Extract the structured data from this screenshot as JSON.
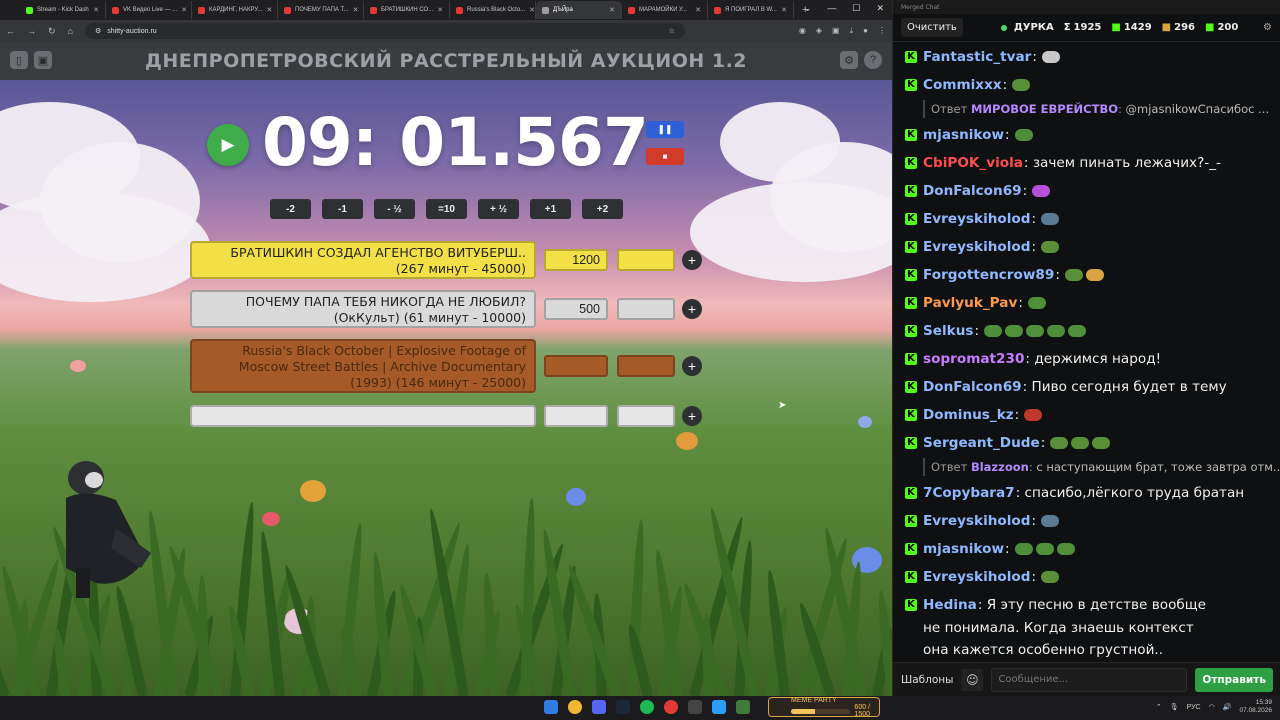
{
  "browser": {
    "tabs": [
      {
        "title": "Stream - Kick Dash",
        "color": "#53fc18",
        "active": false
      },
      {
        "title": "VK Видео Live — ...",
        "color": "#e53935",
        "active": false
      },
      {
        "title": "КАРДИНГ, НАКРУ...",
        "color": "#e53935",
        "active": false
      },
      {
        "title": "ПОЧЕМУ ПАПА Т...",
        "color": "#e53935",
        "active": false
      },
      {
        "title": "БРАТИШКИН СО...",
        "color": "#e53935",
        "active": false
      },
      {
        "title": "Russia's Black Octo...",
        "color": "#e53935",
        "active": false
      },
      {
        "title": "ДЪЙра",
        "color": "#9e9e9e",
        "active": true
      },
      {
        "title": "МАРАМОЙКИ У...",
        "color": "#e53935",
        "active": false
      },
      {
        "title": "Я ПОИГРАЛ В W...",
        "color": "#e53935",
        "active": false
      }
    ],
    "url": "shitty-auction.ru"
  },
  "auction": {
    "title": "ДНЕПРОПЕТРОВСКИЙ РАССТРЕЛЬНЫЙ АУКЦИОН 1.2",
    "timer": "09: 01.567",
    "steps": [
      "-2",
      "-1",
      "- ½",
      "=10",
      "+ ½",
      "+1",
      "+2"
    ],
    "lots": [
      {
        "name": "БРАТИШКИН СОЗДАЛ АГЕНСТВО ВИТУБЕРШ.. (267 минут - 45000)",
        "amount": "1200",
        "color": "#f2e046"
      },
      {
        "name": "ПОЧЕМУ ПАПА ТЕБЯ НИКОГДА НЕ ЛЮБИЛ? (ОкКульт) (61 минут - 10000)",
        "amount": "500",
        "color": "#d9d9d9"
      },
      {
        "name": "Russia's Black October | Explosive Footage of Moscow Street Battles | Archive Documentary (1993) (146 минут - 25000)",
        "amount": "",
        "color": "#a55a28"
      },
      {
        "name": "",
        "amount": "",
        "color": "#e6e6e6"
      }
    ]
  },
  "chat": {
    "window_title": "Merged Chat",
    "clear_label": "Очистить",
    "channel": "ДУРКА",
    "stats": [
      {
        "prefix": "Σ",
        "value": "1925"
      },
      {
        "prefix": "",
        "value": "1429"
      },
      {
        "prefix": "",
        "value": "296"
      },
      {
        "prefix": "",
        "value": "200"
      }
    ],
    "messages": [
      {
        "user": "Fantastic_tvar",
        "color": "#8fb8ff",
        "text": "",
        "emotes": [
          "#c8c8c8"
        ]
      },
      {
        "user": "Commixxx",
        "color": "#8fb8ff",
        "text": "",
        "emotes": [
          "#5a8f3a"
        ]
      },
      {
        "reply": true,
        "label": "Ответ",
        "to": "МИРОВОЕ ЕВРЕЙСТВО",
        "text": "@mjasnikowСпасибос ..."
      },
      {
        "user": "mjasnikow",
        "color": "#8fb8ff",
        "text": "",
        "emotes": [
          "#4f8f3a"
        ]
      },
      {
        "user": "CbiPOK_viola",
        "color": "#ff4d4d",
        "text": "зачем пинать лежачих?-_-",
        "emotes": []
      },
      {
        "user": "DonFalcon69",
        "color": "#8fb8ff",
        "text": "",
        "emotes": [
          "#b84fd9"
        ]
      },
      {
        "user": "Evreyskiholod",
        "color": "#8fb8ff",
        "text": "",
        "emotes": [
          "#5b7a94"
        ]
      },
      {
        "user": "Evreyskiholod",
        "color": "#8fb8ff",
        "text": "",
        "emotes": [
          "#5a8f3a"
        ]
      },
      {
        "user": "Forgottencrow89",
        "color": "#8fb8ff",
        "text": "",
        "emotes": [
          "#5a8f3a",
          "#d9a441"
        ]
      },
      {
        "user": "Pavlyuk_Pav",
        "color": "#ff9a4d",
        "text": "",
        "emotes": [
          "#4f8f3a"
        ]
      },
      {
        "user": "Selkus",
        "color": "#8fb8ff",
        "text": "",
        "emotes": [
          "#4f8f3a",
          "#4f8f3a",
          "#4f8f3a",
          "#4f8f3a",
          "#4f8f3a"
        ]
      },
      {
        "user": "sopromat230",
        "color": "#c77dff",
        "text": "держимся народ!",
        "emotes": []
      },
      {
        "user": "DonFalcon69",
        "color": "#8fb8ff",
        "text": "Пиво сегодня будет в тему",
        "emotes": []
      },
      {
        "user": "Dominus_kz",
        "color": "#8fb8ff",
        "text": "",
        "emotes": [
          "#c0392b"
        ]
      },
      {
        "user": "Sergeant_Dude",
        "color": "#8fb8ff",
        "text": "",
        "emotes": [
          "#5a8f3a",
          "#5a8f3a",
          "#5a8f3a"
        ]
      },
      {
        "reply": true,
        "label": "Ответ",
        "to": "Blazzoon",
        "text": "с наступающим брат, тоже завтра отм..."
      },
      {
        "user": "7Copybara7",
        "color": "#8fb8ff",
        "text": "спасибо,лёгкого труда братан",
        "emotes": []
      },
      {
        "user": "Evreyskiholod",
        "color": "#8fb8ff",
        "text": "",
        "emotes": [
          "#5b7a94"
        ]
      },
      {
        "user": "mjasnikow",
        "color": "#8fb8ff",
        "text": "",
        "emotes": [
          "#4f8f3a",
          "#4f8f3a",
          "#4f8f3a"
        ]
      },
      {
        "user": "Evreyskiholod",
        "color": "#8fb8ff",
        "text": "",
        "emotes": [
          "#5a8f3a"
        ]
      },
      {
        "user": "Hedina",
        "color": "#8fb8ff",
        "text": "Я эту песню в детстве вообще не понимала. Когда знаешь контекст она кажется особенно грустной..",
        "emotes": []
      }
    ],
    "templates_label": "Шаблоны",
    "input_placeholder": "Сообщение...",
    "send_label": "Отправить"
  },
  "taskbar": {
    "meme_title": "MEME PARTY",
    "meme_progress": "600 / 1500",
    "meme_fraction": 0.4,
    "lang": "РУС",
    "time": "15:39",
    "date": "07.08.2026"
  }
}
